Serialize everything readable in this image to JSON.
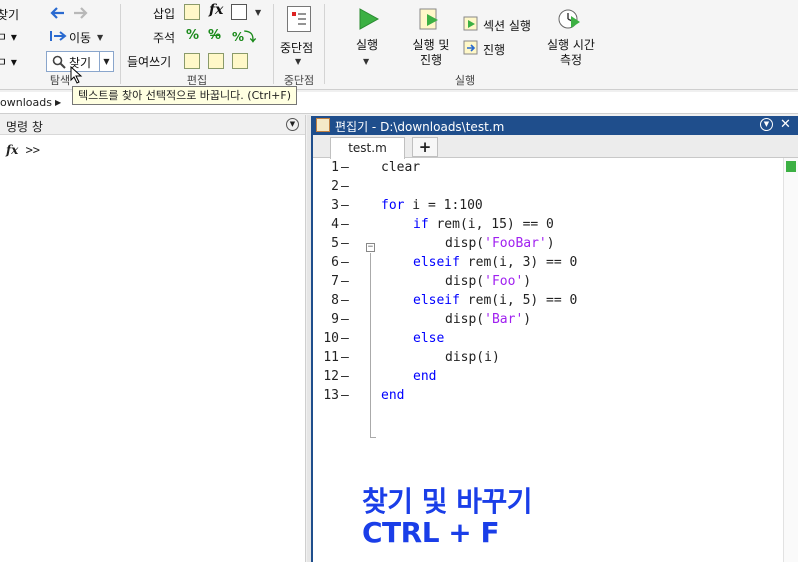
{
  "ribbon": {
    "nav": {
      "find_files": "찾기",
      "goto": "이동",
      "find": "찾기",
      "section_label": "탐색"
    },
    "edit": {
      "insert": "삽입",
      "comment": "주석",
      "indent": "들여쓰기",
      "section_label": "편집"
    },
    "breakpoints": {
      "label": "중단점",
      "section_label": "중단점"
    },
    "run": {
      "run": "실행",
      "run_and_advance": "실행 및\n진행",
      "run_section": "섹션 실행",
      "advance": "진행",
      "run_and_time": "실행 시간\n측정",
      "section_label": "실행"
    }
  },
  "tooltip": "텍스트를 찾아 선택적으로 바꿉니다. (Ctrl+F)",
  "address": {
    "path": "ownloads"
  },
  "command_window": {
    "title": "명령 창",
    "prompt": ">>"
  },
  "editor": {
    "title": "편집기 - D:\\downloads\\test.m",
    "tab": "test.m",
    "add_tab": "+",
    "lines": [
      {
        "n": "1",
        "segments": [
          {
            "t": "clear",
            "c": "plain"
          }
        ],
        "indent": 0
      },
      {
        "n": "2",
        "segments": [],
        "indent": 0
      },
      {
        "n": "3",
        "segments": [
          {
            "t": "for",
            "c": "kw"
          },
          {
            "t": " i = 1:100",
            "c": "plain"
          }
        ],
        "indent": 0
      },
      {
        "n": "4",
        "segments": [
          {
            "t": "if",
            "c": "kw"
          },
          {
            "t": " rem(i, 15) == 0",
            "c": "plain"
          }
        ],
        "indent": 1
      },
      {
        "n": "5",
        "segments": [
          {
            "t": "disp(",
            "c": "plain"
          },
          {
            "t": "'FooBar'",
            "c": "str"
          },
          {
            "t": ")",
            "c": "plain"
          }
        ],
        "indent": 2
      },
      {
        "n": "6",
        "segments": [
          {
            "t": "elseif",
            "c": "kw"
          },
          {
            "t": " rem(i, 3) == 0",
            "c": "plain"
          }
        ],
        "indent": 1
      },
      {
        "n": "7",
        "segments": [
          {
            "t": "disp(",
            "c": "plain"
          },
          {
            "t": "'Foo'",
            "c": "str"
          },
          {
            "t": ")",
            "c": "plain"
          }
        ],
        "indent": 2
      },
      {
        "n": "8",
        "segments": [
          {
            "t": "elseif",
            "c": "kw"
          },
          {
            "t": " rem(i, 5) == 0",
            "c": "plain"
          }
        ],
        "indent": 1
      },
      {
        "n": "9",
        "segments": [
          {
            "t": "disp(",
            "c": "plain"
          },
          {
            "t": "'Bar'",
            "c": "str"
          },
          {
            "t": ")",
            "c": "plain"
          }
        ],
        "indent": 2
      },
      {
        "n": "10",
        "segments": [
          {
            "t": "else",
            "c": "kw"
          }
        ],
        "indent": 1
      },
      {
        "n": "11",
        "segments": [
          {
            "t": "disp(i)",
            "c": "plain"
          }
        ],
        "indent": 2
      },
      {
        "n": "12",
        "segments": [
          {
            "t": "end",
            "c": "kw"
          }
        ],
        "indent": 1
      },
      {
        "n": "13",
        "segments": [
          {
            "t": "end",
            "c": "kw"
          }
        ],
        "indent": 0
      }
    ]
  },
  "caption": {
    "line1": "찾기 및 바꾸기",
    "line2": "CTRL + F"
  },
  "colors": {
    "keyword": "#0000ff",
    "string": "#a020f0",
    "editor_title_bg": "#1f4e8c",
    "caption": "#1a3ee8",
    "run_green": "#3cb043"
  }
}
